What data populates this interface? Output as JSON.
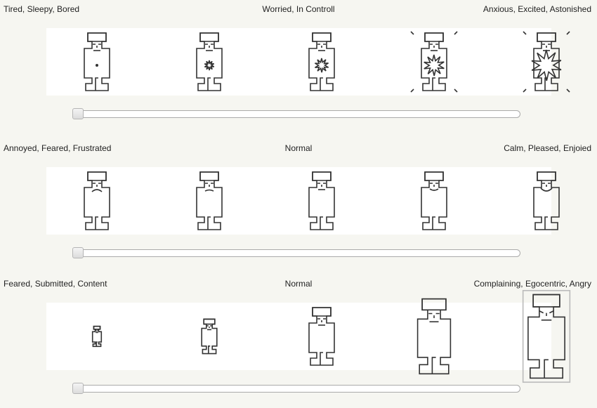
{
  "rows": [
    {
      "left_label": "Tired, Sleepy, Bored",
      "center_label": "Worried, In Controll",
      "right_label": "Anxious, Excited, Astonished",
      "slider_value": 0
    },
    {
      "left_label": "Annoyed, Feared, Frustrated",
      "center_label": "Normal",
      "right_label": "Calm, Pleased, Enjoied",
      "slider_value": 0
    },
    {
      "left_label": "Feared, Submitted, Content",
      "center_label": "Normal",
      "right_label": "Complaining, Egocentric, Angry",
      "slider_value": 0
    }
  ],
  "icons": {
    "figure": "robot-figure-icon",
    "explosion": "heart-explosion-icon",
    "slider_thumb": "slider-thumb-icon"
  },
  "colors": {
    "background": "#f6f6f1",
    "panel": "#ffffff",
    "stroke": "#333333"
  }
}
